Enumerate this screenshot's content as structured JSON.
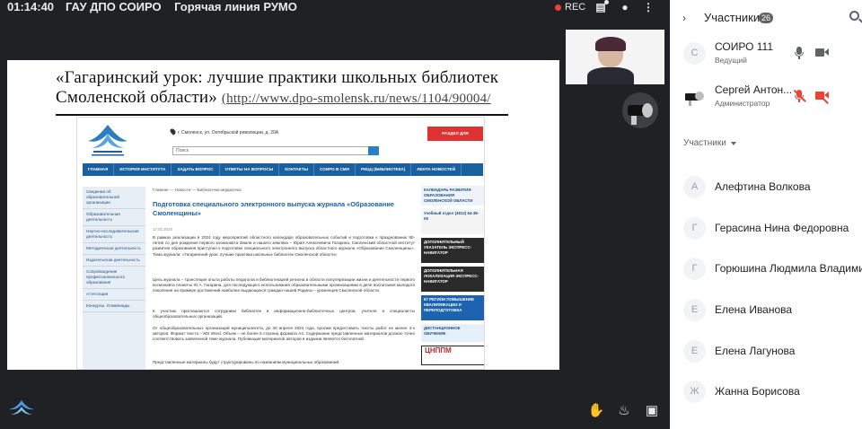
{
  "topbar": {
    "time": "01:14:40",
    "meeting_name": "ГАУ ДПО СОИРО",
    "presenter_name": "Горячая линия РУМО",
    "rec_label": "REC"
  },
  "slide": {
    "title": "«Гагаринский урок: лучшие практики школьных библиотек Смоленской области»",
    "url": "(http://www.dpo-smolensk.ru/news/1104/90004/"
  },
  "webpage": {
    "address": "г. Смоленск, ул. Октябрьской революции, д. 20А",
    "search_placeholder": "Поиск",
    "staff_button": "РАЗДЕЛ ДЛЯ СОТРУДНИКОВ",
    "nav": [
      "ГЛАВНАЯ",
      "ИСТОРИЯ ИНСТИТУТА",
      "ЗАДАТЬ ВОПРОС",
      "ОТВЕТЫ НА ВОПРОСЫ",
      "КОНТАКТЫ",
      "СОИРО В СМИ",
      "РИЦЦ (БИБЛИОТЕКА)",
      "ЛЕНТА НОВОСТЕЙ"
    ],
    "sidebar": [
      "Сведения об образовательной организации",
      "Образовательная деятельность",
      "Научно-исследовательская деятельность",
      "Методическая деятельность",
      "Издательская деятельность",
      "Сопровождение профессионального образования",
      "Аттестация",
      "Конкурсы. Олимпиады."
    ],
    "breadcrumb": "Главная — Новости — Библиотека-медиатека",
    "headline": "Подготовка специального электронного выпуска журнала «Образование Смоленщины»",
    "date": "17.01.2024",
    "paragraphs": [
      "В рамках реализации в 2024 году мероприятий областного календаря образовательных событий и подготовки к празднованию 90-летия со дня рождения первого космонавта Земли и нашего земляка – Юрия Алексеевича Гагарина, Смоленский областной институт развития образования приступил к подготовке специального электронного выпуска областного журнала «Образование Смоленщины». Тема журнала: «Гагаринский урок: лучшие практики школьных библиотек Смоленской области».",
      "Цель журнала – трансляция опыта работы педагогов и библиотекарей региона в области популяризации жизни и деятельности первого космонавта планеты Ю.А. Гагарина, для последующего использования образовательными организациями в деле воспитания молодого поколения на примере достижений наиболее выдающихся граждан нашей Родины – уроженцев Смоленской области.",
      "К участию приглашаются сотрудники библиотек и информационно-библиотечных центров, учителя и специалисты общеобразовательных организаций.",
      "От общеобразовательных организаций муниципалитета, до 30 апреля 2024 года, просим предоставить тексты работ не менее 3-х авторов. Формат текста – MS Word. Объем – не более 5 страниц формата А4. Содержание представленных материалов должно точно соответствовать заявленной теме журнала. Публикация материалов авторов в издании является бесплатной.",
      "Представленные материалы будут структурированы по названиям муниципальных образований."
    ],
    "ads": [
      "КАЛЕНДАРЬ РАЗВИТИЯ ОБРАЗОВАНИЯ СМОЛЕНСКОЙ ОБЛАСТИ",
      "Учебный отдел (4812) 64-38-05",
      "ДОПОЛНИТЕЛЬНЫЙ УКАЗАТЕЛЬ ЭКСПРЕСС-НАВИГАТОР",
      "ДОПОЛНИТЕЛЬНАЯ ЛОКАЛИЗАЦИЯ ЭКСПРЕСС-НАВИГАТОР",
      "67 РЕГИОН ПОВЫШЕНИЕ КВАЛИФИКАЦИИ И ПЕРЕПОДГОТОВКА",
      "ДИСТАНЦИОННОЕ ОБУЧЕНИЕ",
      "ЦНППМ"
    ],
    "colors": {
      "nav": "#1a5f9e",
      "staff_button": "#d33333"
    }
  },
  "panel": {
    "title": "Участники",
    "count": "26",
    "section_label": "Участники",
    "pinned": [
      {
        "initial": "С",
        "name": "СОИРО 111",
        "role": "Ведущий",
        "mic": "on",
        "video": "on"
      },
      {
        "initial": "",
        "name": "Сергей Антон...",
        "role": "Администратор",
        "mic": "muted",
        "video": "muted"
      }
    ],
    "participants": [
      {
        "initial": "А",
        "name": "Алефтина Волкова"
      },
      {
        "initial": "Г",
        "name": "Герасина Нина Федоровна"
      },
      {
        "initial": "Г",
        "name": "Горюшина Людмила Владими..."
      },
      {
        "initial": "Е",
        "name": "Елена Иванова"
      },
      {
        "initial": "Е",
        "name": "Елена Лагунова"
      },
      {
        "initial": "Ж",
        "name": "Жанна Борисова"
      }
    ]
  },
  "icons": {
    "chat": "chat-icon",
    "person": "person-icon",
    "more": "more-vert-icon",
    "raise_hand": "hand-icon",
    "fire": "fire-icon",
    "screen": "screen-share-icon"
  }
}
